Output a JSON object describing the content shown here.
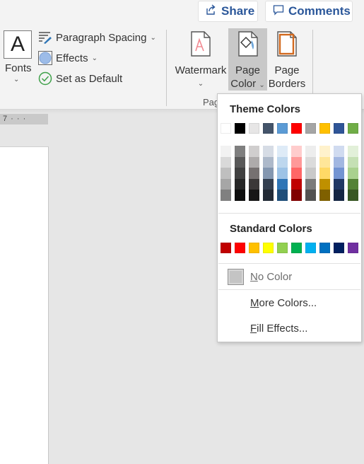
{
  "header": {
    "share_label": "Share",
    "comments_label": "Comments"
  },
  "ribbon": {
    "fonts_glyph": "A",
    "fonts_label": "Fonts",
    "paragraph_spacing_label": "Paragraph Spacing",
    "effects_label": "Effects",
    "set_default_label": "Set as Default",
    "watermark_label": "Watermark",
    "page_color_line1": "Page",
    "page_color_line2": "Color",
    "page_borders_line1": "Page",
    "page_borders_line2": "Borders",
    "group_label": "Pag"
  },
  "ruler": {
    "text": "7 · · ·"
  },
  "dropdown": {
    "theme_heading": "Theme Colors",
    "theme_colors": [
      "#ffffff",
      "#000000",
      "#e7e6e6",
      "#44546a",
      "#5b9bd5",
      "#ff0000",
      "#a5a5a5",
      "#ffc000",
      "#2f5597",
      "#70ad47"
    ],
    "theme_shades": [
      [
        "#f2f2f2",
        "#d9d9d9",
        "#bfbfbf",
        "#a6a6a6",
        "#808080"
      ],
      [
        "#7f7f7f",
        "#595959",
        "#404040",
        "#262626",
        "#0d0d0d"
      ],
      [
        "#d0cece",
        "#aeabab",
        "#767171",
        "#3b3838",
        "#171616"
      ],
      [
        "#d6dce5",
        "#adb9ca",
        "#8497b0",
        "#333f50",
        "#222a35"
      ],
      [
        "#deebf7",
        "#bdd7ee",
        "#9dc3e6",
        "#2e75b6",
        "#1f4e79"
      ],
      [
        "#ffcccc",
        "#ff9999",
        "#ff6666",
        "#c00000",
        "#800000"
      ],
      [
        "#ededed",
        "#dbdbdb",
        "#c9c9c9",
        "#7b7b7b",
        "#525252"
      ],
      [
        "#fff2cc",
        "#ffe699",
        "#ffd966",
        "#bf9000",
        "#7f6000"
      ],
      [
        "#d0dbf0",
        "#a2b7e1",
        "#7394d2",
        "#203864",
        "#152643"
      ],
      [
        "#e2f0d9",
        "#c5e0b4",
        "#a9d18e",
        "#548235",
        "#385723"
      ]
    ],
    "standard_heading": "Standard Colors",
    "standard_colors": [
      "#c00000",
      "#ff0000",
      "#ffc000",
      "#ffff00",
      "#92d050",
      "#00b050",
      "#00b0f0",
      "#0070c0",
      "#002060",
      "#7030a0"
    ],
    "no_color_label": "No Color",
    "no_color_accel": "N",
    "no_color_rest": "o Color",
    "more_colors_accel": "M",
    "more_colors_rest": "ore Colors...",
    "fill_effects_accel": "F",
    "fill_effects_rest": "ill Effects..."
  }
}
